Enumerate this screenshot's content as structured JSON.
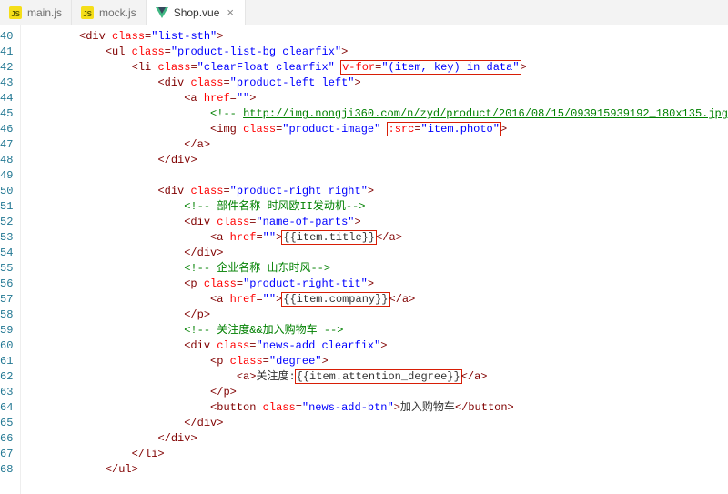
{
  "tabs": [
    {
      "label": "main.js",
      "icon": "js",
      "active": false
    },
    {
      "label": "mock.js",
      "icon": "js",
      "active": false
    },
    {
      "label": "Shop.vue",
      "icon": "vue",
      "active": true
    }
  ],
  "close_glyph": "×",
  "line_start": 40,
  "line_end": 68,
  "code_lines": [
    {
      "indent": 2,
      "parts": [
        {
          "cls": "p-tag",
          "t": "<div"
        },
        {
          "cls": "p-txt",
          "t": " "
        },
        {
          "cls": "p-attr",
          "t": "class"
        },
        {
          "cls": "p-tag",
          "t": "="
        },
        {
          "cls": "p-str",
          "t": "\"list-sth\""
        },
        {
          "cls": "p-tag",
          "t": ">"
        }
      ]
    },
    {
      "indent": 3,
      "parts": [
        {
          "cls": "p-tag",
          "t": "<ul"
        },
        {
          "cls": "p-txt",
          "t": " "
        },
        {
          "cls": "p-attr",
          "t": "class"
        },
        {
          "cls": "p-tag",
          "t": "="
        },
        {
          "cls": "p-str",
          "t": "\"product-list-bg clearfix\""
        },
        {
          "cls": "p-tag",
          "t": ">"
        }
      ]
    },
    {
      "indent": 4,
      "parts": [
        {
          "cls": "p-tag",
          "t": "<li"
        },
        {
          "cls": "p-txt",
          "t": " "
        },
        {
          "cls": "p-attr",
          "t": "class"
        },
        {
          "cls": "p-tag",
          "t": "="
        },
        {
          "cls": "p-str",
          "t": "\"clearFloat clearfix\""
        },
        {
          "cls": "p-txt",
          "t": " "
        },
        {
          "hl": true,
          "inner": [
            {
              "cls": "p-attr",
              "t": "v-for"
            },
            {
              "cls": "p-tag",
              "t": "="
            },
            {
              "cls": "p-str",
              "t": "\"(item, key) in data\""
            }
          ]
        },
        {
          "cls": "p-tag",
          "t": ">"
        }
      ]
    },
    {
      "indent": 5,
      "parts": [
        {
          "cls": "p-tag",
          "t": "<div"
        },
        {
          "cls": "p-txt",
          "t": " "
        },
        {
          "cls": "p-attr",
          "t": "class"
        },
        {
          "cls": "p-tag",
          "t": "="
        },
        {
          "cls": "p-str",
          "t": "\"product-left left\""
        },
        {
          "cls": "p-tag",
          "t": ">"
        }
      ]
    },
    {
      "indent": 6,
      "parts": [
        {
          "cls": "p-tag",
          "t": "<a"
        },
        {
          "cls": "p-txt",
          "t": " "
        },
        {
          "cls": "p-attr",
          "t": "href"
        },
        {
          "cls": "p-tag",
          "t": "="
        },
        {
          "cls": "p-str",
          "t": "\"\""
        },
        {
          "cls": "p-tag",
          "t": ">"
        }
      ]
    },
    {
      "indent": 7,
      "parts": [
        {
          "cls": "p-com",
          "t": "<!-- "
        },
        {
          "cls": "p-url",
          "t": "http://img.nongji360.com/n/zyd/product/2016/08/15/093915939192_180x135.jpg"
        },
        {
          "cls": "p-com",
          "t": " -->"
        }
      ]
    },
    {
      "indent": 7,
      "parts": [
        {
          "cls": "p-tag",
          "t": "<img"
        },
        {
          "cls": "p-txt",
          "t": " "
        },
        {
          "cls": "p-attr",
          "t": "class"
        },
        {
          "cls": "p-tag",
          "t": "="
        },
        {
          "cls": "p-str",
          "t": "\"product-image\""
        },
        {
          "cls": "p-txt",
          "t": " "
        },
        {
          "hl": true,
          "inner": [
            {
              "cls": "p-attr",
              "t": ":src"
            },
            {
              "cls": "p-tag",
              "t": "="
            },
            {
              "cls": "p-str",
              "t": "\"item.photo\""
            }
          ]
        },
        {
          "cls": "p-tag",
          "t": ">"
        }
      ]
    },
    {
      "indent": 6,
      "parts": [
        {
          "cls": "p-tag",
          "t": "</a>"
        }
      ]
    },
    {
      "indent": 5,
      "parts": [
        {
          "cls": "p-tag",
          "t": "</div>"
        }
      ]
    },
    {
      "indent": 0,
      "parts": [
        {
          "cls": "p-txt",
          "t": ""
        }
      ]
    },
    {
      "indent": 5,
      "parts": [
        {
          "cls": "p-tag",
          "t": "<div"
        },
        {
          "cls": "p-txt",
          "t": " "
        },
        {
          "cls": "p-attr",
          "t": "class"
        },
        {
          "cls": "p-tag",
          "t": "="
        },
        {
          "cls": "p-str",
          "t": "\"product-right right\""
        },
        {
          "cls": "p-tag",
          "t": ">"
        }
      ]
    },
    {
      "indent": 6,
      "parts": [
        {
          "cls": "p-com",
          "t": "<!-- 部件名称 时风欧II发动机-->"
        }
      ]
    },
    {
      "indent": 6,
      "parts": [
        {
          "cls": "p-tag",
          "t": "<div"
        },
        {
          "cls": "p-txt",
          "t": " "
        },
        {
          "cls": "p-attr",
          "t": "class"
        },
        {
          "cls": "p-tag",
          "t": "="
        },
        {
          "cls": "p-str",
          "t": "\"name-of-parts\""
        },
        {
          "cls": "p-tag",
          "t": ">"
        }
      ]
    },
    {
      "indent": 7,
      "parts": [
        {
          "cls": "p-tag",
          "t": "<a"
        },
        {
          "cls": "p-txt",
          "t": " "
        },
        {
          "cls": "p-attr",
          "t": "href"
        },
        {
          "cls": "p-tag",
          "t": "="
        },
        {
          "cls": "p-str",
          "t": "\"\""
        },
        {
          "cls": "p-tag",
          "t": ">"
        },
        {
          "hl": true,
          "inner": [
            {
              "cls": "p-txt",
              "t": "{{item.title}}"
            }
          ]
        },
        {
          "cls": "p-tag",
          "t": "</a>"
        }
      ]
    },
    {
      "indent": 6,
      "parts": [
        {
          "cls": "p-tag",
          "t": "</div>"
        }
      ]
    },
    {
      "indent": 6,
      "parts": [
        {
          "cls": "p-com",
          "t": "<!-- 企业名称 山东时风-->"
        }
      ]
    },
    {
      "indent": 6,
      "parts": [
        {
          "cls": "p-tag",
          "t": "<p"
        },
        {
          "cls": "p-txt",
          "t": " "
        },
        {
          "cls": "p-attr",
          "t": "class"
        },
        {
          "cls": "p-tag",
          "t": "="
        },
        {
          "cls": "p-str",
          "t": "\"product-right-tit\""
        },
        {
          "cls": "p-tag",
          "t": ">"
        }
      ]
    },
    {
      "indent": 7,
      "parts": [
        {
          "cls": "p-tag",
          "t": "<a"
        },
        {
          "cls": "p-txt",
          "t": " "
        },
        {
          "cls": "p-attr",
          "t": "href"
        },
        {
          "cls": "p-tag",
          "t": "="
        },
        {
          "cls": "p-str",
          "t": "\"\""
        },
        {
          "cls": "p-tag",
          "t": ">"
        },
        {
          "hl": true,
          "inner": [
            {
              "cls": "p-txt",
              "t": "{{item.company}}"
            }
          ]
        },
        {
          "cls": "p-tag",
          "t": "</a>"
        }
      ]
    },
    {
      "indent": 6,
      "parts": [
        {
          "cls": "p-tag",
          "t": "</p>"
        }
      ]
    },
    {
      "indent": 6,
      "parts": [
        {
          "cls": "p-com",
          "t": "<!-- 关注度&&加入购物车 -->"
        }
      ]
    },
    {
      "indent": 6,
      "parts": [
        {
          "cls": "p-tag",
          "t": "<div"
        },
        {
          "cls": "p-txt",
          "t": " "
        },
        {
          "cls": "p-attr",
          "t": "class"
        },
        {
          "cls": "p-tag",
          "t": "="
        },
        {
          "cls": "p-str",
          "t": "\"news-add clearfix\""
        },
        {
          "cls": "p-tag",
          "t": ">"
        }
      ]
    },
    {
      "indent": 7,
      "parts": [
        {
          "cls": "p-tag",
          "t": "<p"
        },
        {
          "cls": "p-txt",
          "t": " "
        },
        {
          "cls": "p-attr",
          "t": "class"
        },
        {
          "cls": "p-tag",
          "t": "="
        },
        {
          "cls": "p-str",
          "t": "\"degree\""
        },
        {
          "cls": "p-tag",
          "t": ">"
        }
      ]
    },
    {
      "indent": 8,
      "parts": [
        {
          "cls": "p-tag",
          "t": "<a>"
        },
        {
          "cls": "p-txt",
          "t": "关注度:"
        },
        {
          "hl": true,
          "inner": [
            {
              "cls": "p-txt",
              "t": "{{item.attention_degree}}"
            }
          ]
        },
        {
          "cls": "p-tag",
          "t": "</a>"
        }
      ]
    },
    {
      "indent": 7,
      "parts": [
        {
          "cls": "p-tag",
          "t": "</p>"
        }
      ]
    },
    {
      "indent": 7,
      "parts": [
        {
          "cls": "p-tag",
          "t": "<button"
        },
        {
          "cls": "p-txt",
          "t": " "
        },
        {
          "cls": "p-attr",
          "t": "class"
        },
        {
          "cls": "p-tag",
          "t": "="
        },
        {
          "cls": "p-str",
          "t": "\"news-add-btn\""
        },
        {
          "cls": "p-tag",
          "t": ">"
        },
        {
          "cls": "p-txt",
          "t": "加入购物车"
        },
        {
          "cls": "p-tag",
          "t": "</button>"
        }
      ]
    },
    {
      "indent": 6,
      "parts": [
        {
          "cls": "p-tag",
          "t": "</div>"
        }
      ]
    },
    {
      "indent": 5,
      "parts": [
        {
          "cls": "p-tag",
          "t": "</div>"
        }
      ]
    },
    {
      "indent": 4,
      "parts": [
        {
          "cls": "p-tag",
          "t": "</li>"
        }
      ]
    },
    {
      "indent": 3,
      "parts": [
        {
          "cls": "p-tag",
          "t": "</ul>"
        }
      ]
    }
  ]
}
